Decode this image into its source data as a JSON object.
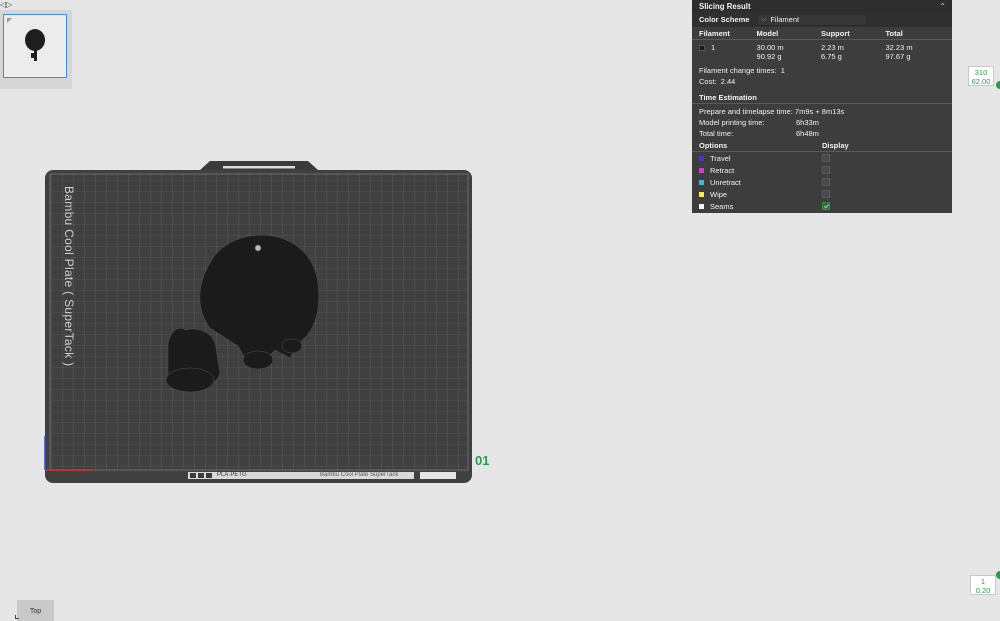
{
  "corner_glyph": "◁▷",
  "plate": {
    "label_vertical": "Bambu Cool Plate ( SuperTack )",
    "label_bottom": "Bambu Cool Plate  SuperTack",
    "filament_tag": "PLA·PETG",
    "plate_number": "01"
  },
  "slicing_result": {
    "title": "Slicing Result",
    "color_scheme_label": "Color Scheme",
    "color_scheme_value": "Filament",
    "table": {
      "headers": [
        "Filament",
        "Model",
        "Support",
        "Total"
      ],
      "rows": [
        {
          "filament": "1",
          "model_len": "30.00 m",
          "model_wt": "90.92 g",
          "support_len": "2.23 m",
          "support_wt": "6.75 g",
          "total_len": "32.23 m",
          "total_wt": "97.67 g"
        }
      ]
    },
    "filament_change_label": "Filament change times:",
    "filament_change_value": "1",
    "cost_label": "Cost:",
    "cost_value": "2.44",
    "time_estimation_title": "Time Estimation",
    "prepare_label": "Prepare and timelapse time:",
    "prepare_value": "7m9s + 8m13s",
    "model_time_label": "Model printing time:",
    "model_time_value": "6h33m",
    "total_time_label": "Total time:",
    "total_time_value": "6h48m",
    "options_header": "Options",
    "display_header": "Display",
    "options": [
      {
        "name": "Travel",
        "color": "#3b3bd9",
        "checked": false
      },
      {
        "name": "Retract",
        "color": "#d33ad3",
        "checked": false
      },
      {
        "name": "Unretract",
        "color": "#3ab8d9",
        "checked": false
      },
      {
        "name": "Wipe",
        "color": "#f3f33a",
        "checked": false
      },
      {
        "name": "Seams",
        "color": "#f5f5f5",
        "checked": true
      }
    ]
  },
  "layer_slider": {
    "top_layer": "310",
    "top_height": "62.00",
    "bottom_layer": "1",
    "bottom_height": "0.20"
  },
  "view_button": "Top"
}
